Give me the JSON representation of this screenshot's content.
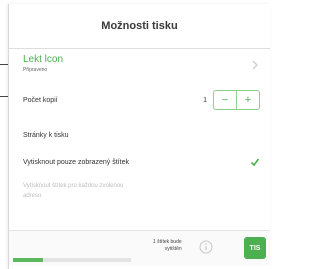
{
  "dialog": {
    "title": "Možnosti tisku"
  },
  "printer": {
    "name": "Lekt lcon",
    "status": "Připraveno"
  },
  "copies": {
    "label": "Počet kopií",
    "value": "1",
    "decrement_symbol": "−",
    "increment_symbol": "+"
  },
  "pages": {
    "label": "Stránky k tisku"
  },
  "selected_only": {
    "label": "Vytisknout pouze zobrazený štítek",
    "checked": true
  },
  "note": {
    "text_line1": "Vytisknout štítek pro každou zvolenou",
    "text_line2": "adresu"
  },
  "footer": {
    "summary_line1": "1 štítek bude",
    "summary_line2": "vytištěn",
    "print_label": "TIS",
    "progress_fraction": 0.25
  },
  "colors": {
    "accent": "#4caf50"
  },
  "icons": {
    "printer_chevron": "chevron-right-icon",
    "selected_check": "check-icon",
    "footer_info": "info-icon"
  }
}
